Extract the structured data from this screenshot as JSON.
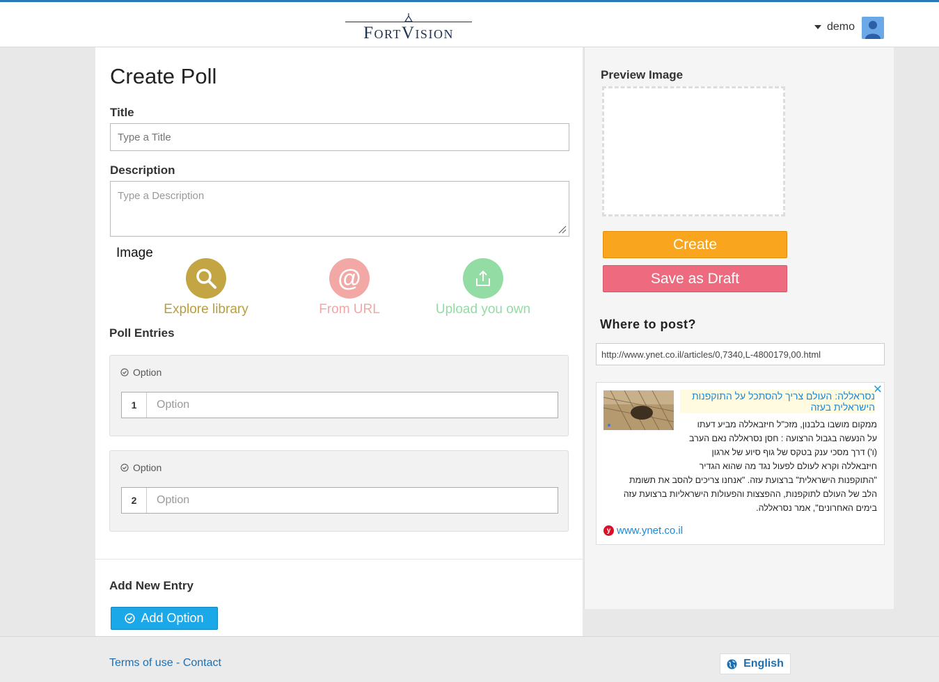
{
  "header": {
    "logo_text": "FortVision",
    "user_name": "demo"
  },
  "form": {
    "page_title": "Create Poll",
    "title_label": "Title",
    "title_placeholder": "Type a Title",
    "description_label": "Description",
    "description_placeholder": "Type a Description",
    "image_label": "Image",
    "image_sources": [
      {
        "label": "Explore library",
        "icon": "search-icon",
        "color": "#c3a643"
      },
      {
        "label": "From URL",
        "icon": "at-icon",
        "color": "#f2a8a4"
      },
      {
        "label": "Upload you own",
        "icon": "upload-icon",
        "color": "#93dca3"
      }
    ],
    "poll_entries_label": "Poll Entries",
    "entries": [
      {
        "heading": "Option",
        "number": "1",
        "placeholder": "Option"
      },
      {
        "heading": "Option",
        "number": "2",
        "placeholder": "Option"
      }
    ],
    "add_new_entry_label": "Add New Entry",
    "add_option_label": "Add Option"
  },
  "side": {
    "preview_label": "Preview Image",
    "create_label": "Create",
    "draft_label": "Save as Draft",
    "where_label": "Where to post?",
    "url_value": "http://www.ynet.co.il/articles/0,7340,L-4800179,00.html",
    "article": {
      "title": "נסראללה: העולם צריך להסתכל על התוקפנות הישראלית בעזה",
      "body_lines": [
        "ממקום מושבו בלבנון, מזכ\"ל חיזבאללה מביע דעתו",
        "על הנעשה בגבול הרצועה : חסן נסראללה נאם הערב",
        "(ו') דרך מסכי ענק בטקס של גוף סיוע של ארגון",
        "חיזבאללה וקרא לעולם לפעול נגד מה שהוא הגדיר",
        "\"התוקפנות הישראלית\" ברצועת עזה. \"אנחנו צריכים להסב את תשומת",
        "הלב של העולם לתוקפנות, ההפצצות והפעולות הישראליות ברצועת עזה",
        "בימים האחרונים\", אמר נסראללה."
      ],
      "source_link": "www.ynet.co.il",
      "source_badge": "y"
    }
  },
  "footer": {
    "terms_label": "Terms of use",
    "separator": " - ",
    "contact_label": "Contact",
    "language_label": "English"
  },
  "colors": {
    "accent_blue": "#1aa8e8",
    "create_orange": "#f9a51e",
    "draft_pink": "#ee6a7e",
    "top_border": "#2a7ab7"
  }
}
